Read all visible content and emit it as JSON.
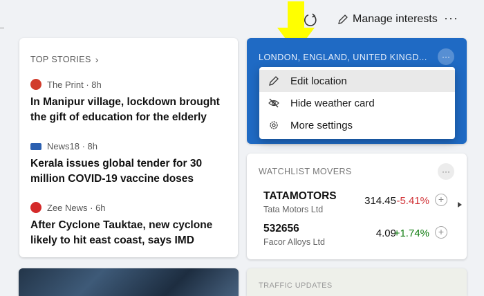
{
  "toolbar": {
    "refresh_icon": "refresh-icon",
    "manage_label": "Manage interests",
    "more_label": "···"
  },
  "top_stories": {
    "title": "TOP STORIES",
    "stories": [
      {
        "source": "The Print · 8h",
        "headline": "In Manipur village, lockdown brought the gift of education for the elderly",
        "icon_color": "#d13c2c"
      },
      {
        "source": "News18 · 8h",
        "headline": "Kerala issues global tender for 30 million COVID-19 vaccine doses",
        "icon_color": "#2a5fb0"
      },
      {
        "source": "Zee News · 6h",
        "headline": "After Cyclone Tauktae, new cyclone likely to hit east coast, says IMD",
        "icon_color": "#d42a2a"
      }
    ]
  },
  "weather": {
    "location": "LONDON, ENGLAND, UNITED KINGD...",
    "more_label": "···",
    "menu": [
      {
        "label": "Edit location",
        "icon": "pencil-icon"
      },
      {
        "label": "Hide weather card",
        "icon": "eye-off-icon"
      },
      {
        "label": "More settings",
        "icon": "gear-icon"
      }
    ]
  },
  "watchlist": {
    "title": "WATCHLIST MOVERS",
    "more_label": "···",
    "stocks": [
      {
        "symbol": "TATAMOTORS",
        "company": "Tata Motors Ltd",
        "price": "314.45",
        "change": "-5.41%"
      },
      {
        "symbol": "532656",
        "company": "Facor Alloys Ltd",
        "price": "4.09",
        "change": "+1.74%"
      }
    ]
  },
  "traffic": {
    "title": "TRAFFIC UPDATES"
  },
  "colors": {
    "weather_bg": "#1f6ac4",
    "arrow": "#ffff00",
    "negative": "#d13438",
    "positive": "#107c10"
  }
}
